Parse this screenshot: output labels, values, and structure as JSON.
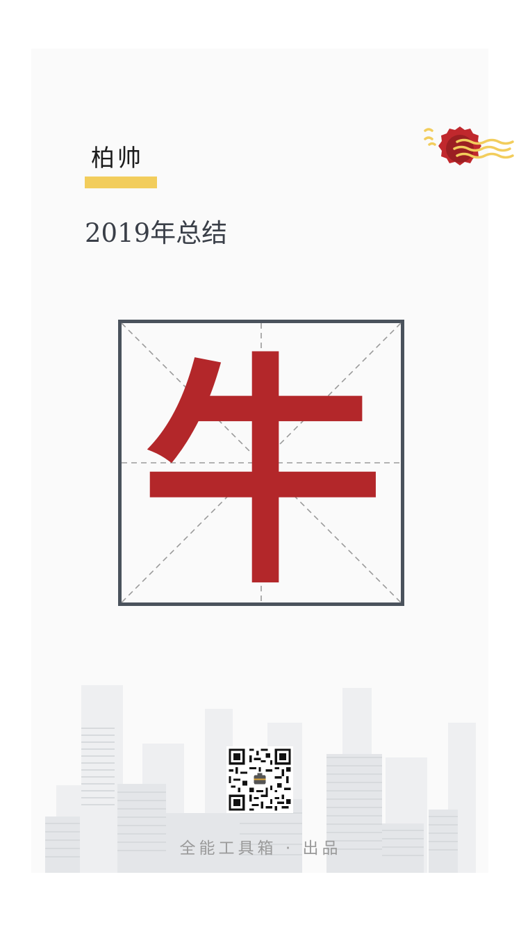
{
  "card": {
    "name": "柏帅",
    "subtitle": "2019年总结",
    "character": "牛"
  },
  "footer": {
    "credit": "全能工具箱 · 出品"
  },
  "colors": {
    "accent_yellow": "#f2cd5c",
    "character_red": "#b3272a",
    "seal_red": "#c0282d",
    "grid_border": "#4a525c",
    "grid_dash": "#9a9a9a"
  },
  "icons": {
    "seal": "wax-seal-icon",
    "qr": "qr-code-icon"
  }
}
